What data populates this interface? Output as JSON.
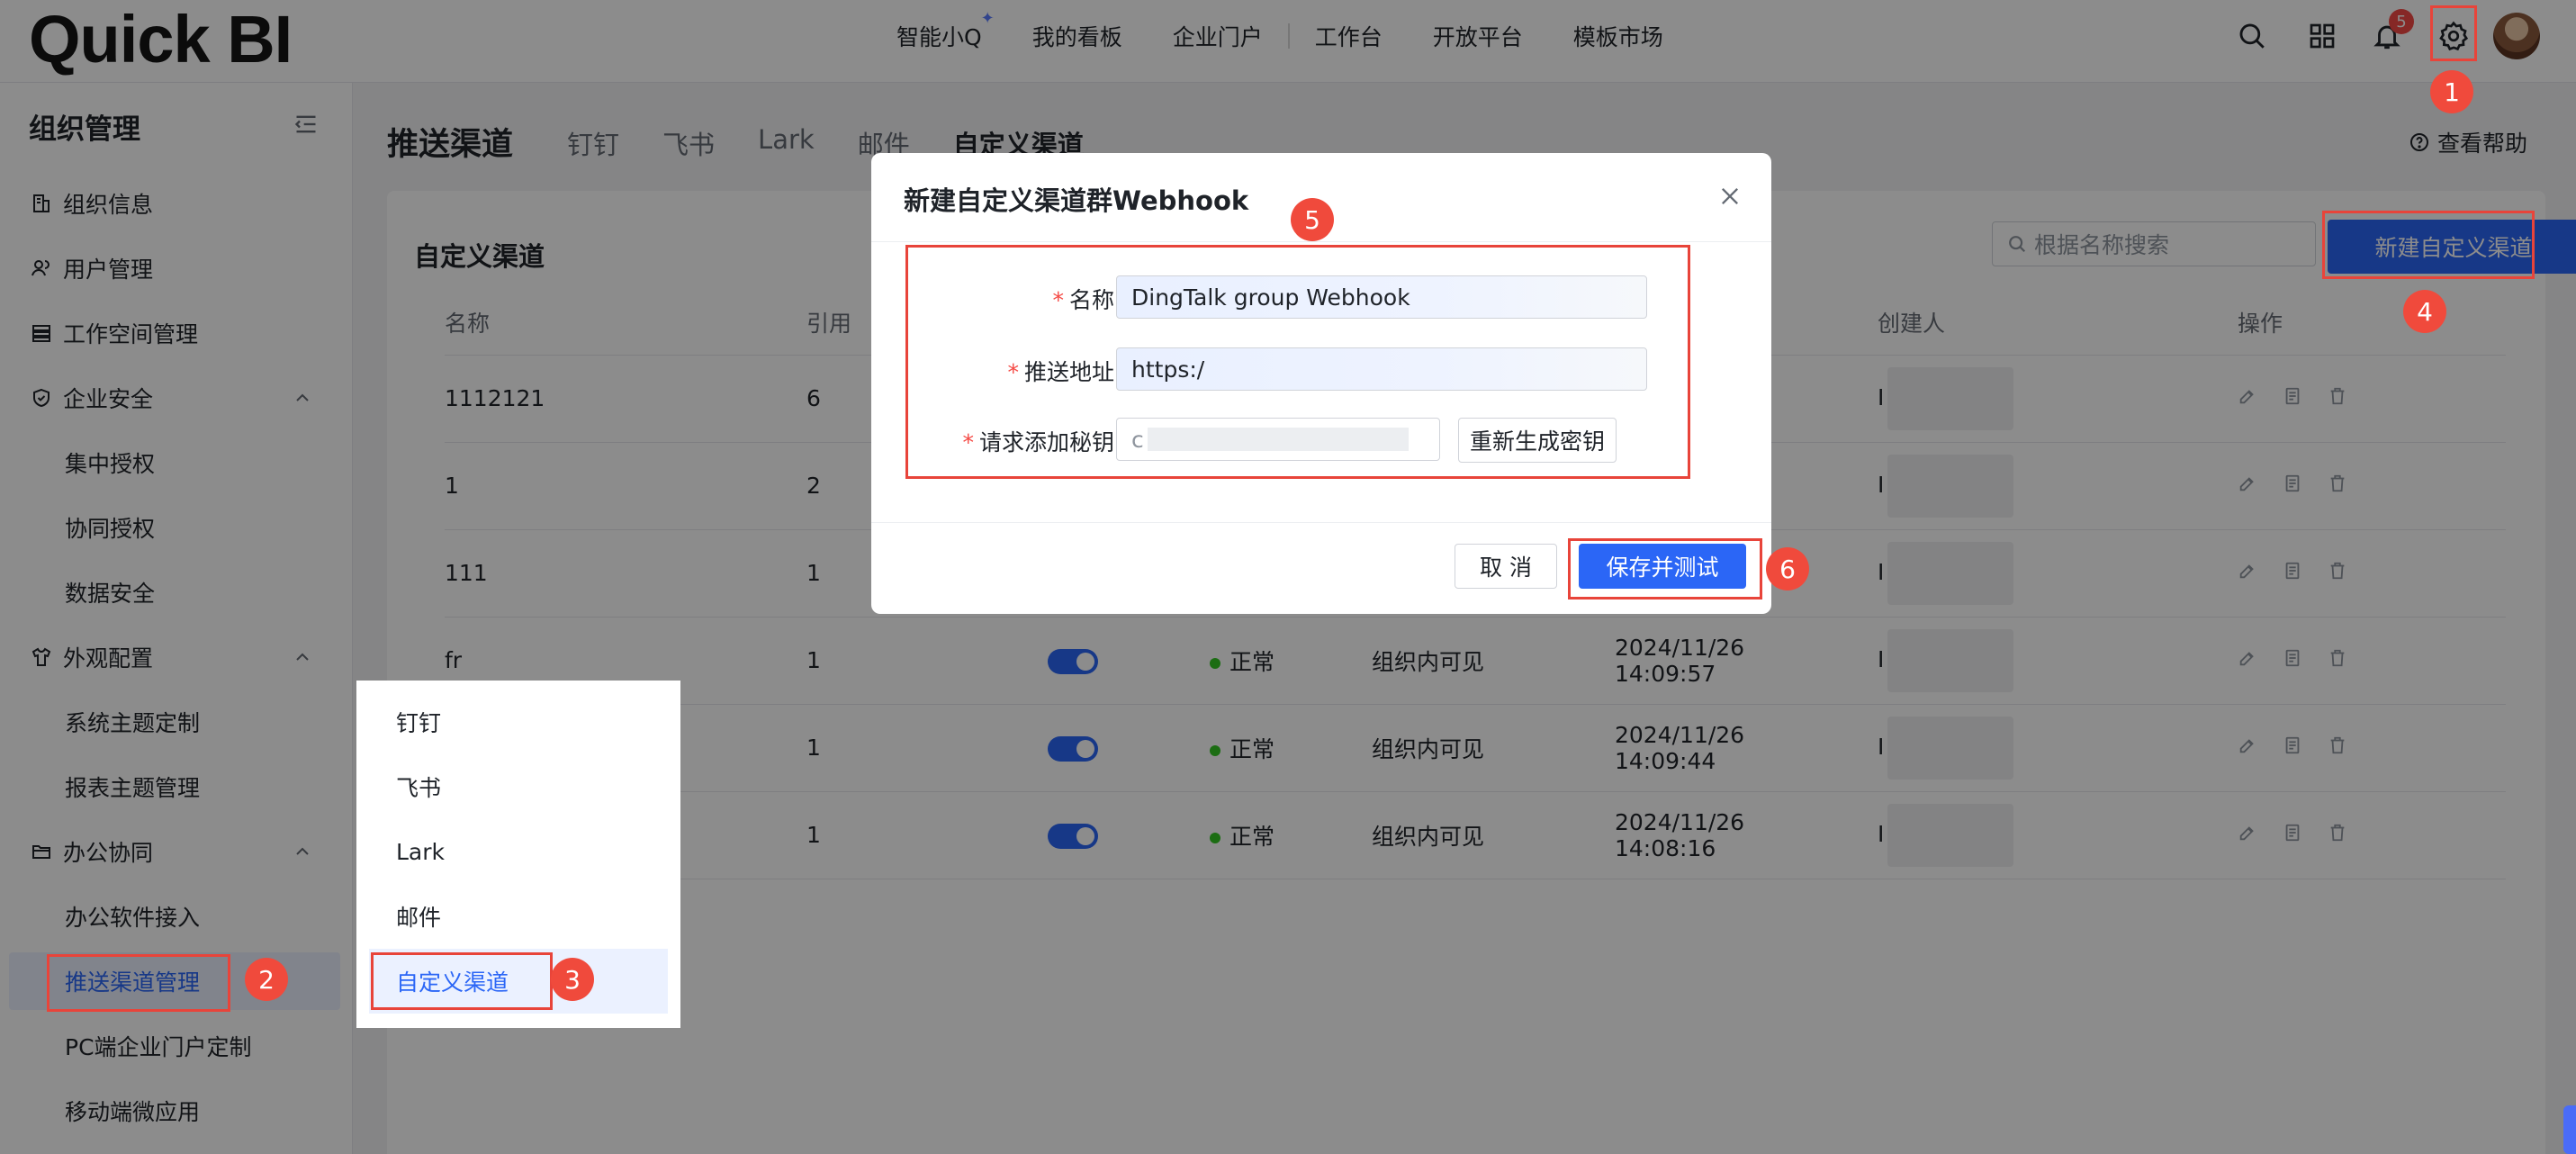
{
  "app": {
    "logo": "Quick BI"
  },
  "topnav": {
    "items": [
      "智能小Q",
      "我的看板",
      "企业门户",
      "工作台",
      "开放平台",
      "模板市场"
    ]
  },
  "top_icons": {
    "search": "search-icon",
    "apps": "grid-icon",
    "bell": "bell-icon",
    "notification_count": "5",
    "settings": "gear-icon"
  },
  "sidebar": {
    "title": "组织管理",
    "items": [
      {
        "label": "组织信息",
        "icon": "building-icon"
      },
      {
        "label": "用户管理",
        "icon": "users-icon"
      },
      {
        "label": "工作空间管理",
        "icon": "stack-icon"
      },
      {
        "label": "企业安全",
        "icon": "shield-icon",
        "expanded": true,
        "children": [
          "集中授权",
          "协同授权",
          "数据安全"
        ]
      },
      {
        "label": "外观配置",
        "icon": "shirt-icon",
        "expanded": true,
        "children": [
          "系统主题定制",
          "报表主题管理"
        ]
      },
      {
        "label": "办公协同",
        "icon": "folder-icon",
        "expanded": true,
        "children": [
          "办公软件接入",
          "推送渠道管理",
          "PC端企业门户定制",
          "移动端微应用"
        ]
      }
    ],
    "active_item": "推送渠道管理"
  },
  "page": {
    "title": "推送渠道",
    "tabs": [
      "钉钉",
      "飞书",
      "Lark",
      "邮件",
      "自定义渠道"
    ],
    "active_tab": "自定义渠道",
    "help": "查看帮助"
  },
  "panel": {
    "title": "自定义渠道",
    "search_placeholder": "根据名称搜索",
    "new_button": "新建自定义渠道",
    "columns": [
      "名称",
      "引用",
      "",
      "",
      "",
      "",
      "创建人",
      "操作"
    ],
    "rows": [
      {
        "name": "1112121",
        "refs": "6",
        "enabled": false,
        "status": "",
        "visibility": "",
        "date": "",
        "time": "",
        "creator": "I"
      },
      {
        "name": "1",
        "refs": "2",
        "enabled": false,
        "status": "",
        "visibility": "",
        "date": "",
        "time": "",
        "creator": "I"
      },
      {
        "name": "111",
        "refs": "1",
        "enabled": false,
        "status": "",
        "visibility": "",
        "date": "",
        "time": "",
        "creator": "I"
      },
      {
        "name": "fr",
        "refs": "1",
        "enabled": true,
        "status": "正常",
        "visibility": "组织内可见",
        "date": "2024/11/26",
        "time": "14:09:57",
        "creator": "I"
      },
      {
        "name": "",
        "refs": "1",
        "enabled": true,
        "status": "正常",
        "visibility": "组织内可见",
        "date": "2024/11/26",
        "time": "14:09:44",
        "creator": "I"
      },
      {
        "name": "",
        "refs": "1",
        "enabled": true,
        "status": "正常",
        "visibility": "组织内可见",
        "date": "2024/11/26",
        "time": "14:08:16",
        "creator": "I"
      }
    ]
  },
  "popup_menu": {
    "items": [
      "钉钉",
      "飞书",
      "Lark",
      "邮件",
      "自定义渠道"
    ],
    "active": "自定义渠道"
  },
  "dialog": {
    "title": "新建自定义渠道群Webhook",
    "fields": {
      "name_label": "名称",
      "name_value": "DingTalk group Webhook",
      "url_label": "推送地址",
      "url_value": "https:/",
      "secret_label": "请求添加秘钥",
      "secret_value": "c",
      "regen_button": "重新生成密钥"
    },
    "cancel": "取 消",
    "save": "保存并测试"
  },
  "annotations": {
    "markers": [
      "1",
      "2",
      "3",
      "4",
      "5",
      "6"
    ],
    "color": "#e8443a"
  },
  "colors": {
    "primary": "#2b66f6",
    "danger": "#f54a45",
    "success": "#34c724"
  }
}
